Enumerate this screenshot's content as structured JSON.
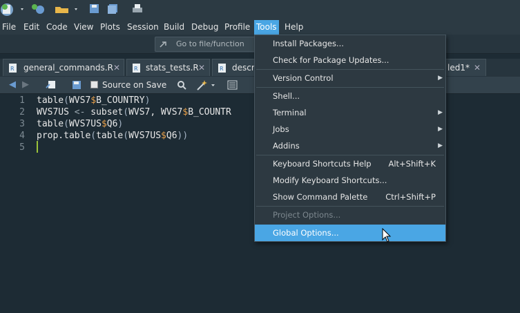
{
  "menubar": {
    "items": [
      "File",
      "Edit",
      "Code",
      "View",
      "Plots",
      "Session",
      "Build",
      "Debug",
      "Profile",
      "Tools",
      "Help"
    ]
  },
  "toolbar": {
    "goto_placeholder": "Go to file/function"
  },
  "tabs": [
    {
      "label": "general_commands.R"
    },
    {
      "label": "stats_tests.R"
    },
    {
      "label": "descri"
    },
    {
      "label": "led1*"
    }
  ],
  "editor_toolbar": {
    "source_on_save": "Source on Save"
  },
  "editor": {
    "line_numbers": [
      "1",
      "2",
      "3",
      "4",
      "5"
    ],
    "lines": [
      "table(WVS7$B_COUNTRY)",
      "WVS7US <- subset(WVS7, WVS7$B_COUNTR",
      "table(WVS7US$Q6)",
      "prop.table(table(WVS7US$Q6))",
      ""
    ]
  },
  "tools_menu": {
    "items": [
      {
        "label": "Install Packages...",
        "shortcut": "",
        "submenu": false,
        "disabled": false,
        "selected": false
      },
      {
        "label": "Check for Package Updates...",
        "shortcut": "",
        "submenu": false,
        "disabled": false,
        "selected": false
      },
      {
        "label": "Version Control",
        "shortcut": "",
        "submenu": true,
        "disabled": false,
        "selected": false
      },
      {
        "label": "Shell...",
        "shortcut": "",
        "submenu": false,
        "disabled": false,
        "selected": false
      },
      {
        "label": "Terminal",
        "shortcut": "",
        "submenu": true,
        "disabled": false,
        "selected": false
      },
      {
        "label": "Jobs",
        "shortcut": "",
        "submenu": true,
        "disabled": false,
        "selected": false
      },
      {
        "label": "Addins",
        "shortcut": "",
        "submenu": true,
        "disabled": false,
        "selected": false
      },
      {
        "label": "Keyboard Shortcuts Help",
        "shortcut": "Alt+Shift+K",
        "submenu": false,
        "disabled": false,
        "selected": false
      },
      {
        "label": "Modify Keyboard Shortcuts...",
        "shortcut": "",
        "submenu": false,
        "disabled": false,
        "selected": false
      },
      {
        "label": "Show Command Palette",
        "shortcut": "Ctrl+Shift+P",
        "submenu": false,
        "disabled": false,
        "selected": false
      },
      {
        "label": "Project Options...",
        "shortcut": "",
        "submenu": false,
        "disabled": true,
        "selected": false
      },
      {
        "label": "Global Options...",
        "shortcut": "",
        "submenu": false,
        "disabled": false,
        "selected": true
      }
    ]
  },
  "colors": {
    "accent": "#4aa6e4",
    "editor_bg": "#1d2b34",
    "menu_bg": "#2d3941"
  }
}
